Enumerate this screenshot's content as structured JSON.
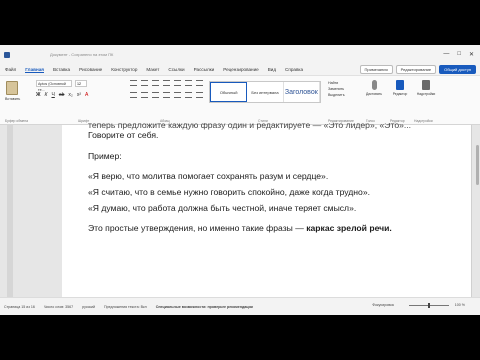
{
  "window": {
    "title": "Документ - Сохранено на этом ПК",
    "controls": [
      "—",
      "□",
      "✕"
    ]
  },
  "menu": {
    "items": [
      "Файл",
      "Главная",
      "Вставка",
      "Рисование",
      "Конструктор",
      "Макет",
      "Ссылки",
      "Рассылки",
      "Рецензирование",
      "Вид",
      "Справка"
    ],
    "active_index": 1,
    "comments_label": "Примечания",
    "editing_label": "Редактирование",
    "share_label": "Общий доступ"
  },
  "ribbon": {
    "paste_label": "Вставить",
    "font_name": "Aptos (Основной те...",
    "font_size": "12",
    "format_buttons": [
      "Ж",
      "К",
      "Ч",
      "ab",
      "x₂",
      "x²",
      "A"
    ],
    "styles": [
      "Обычный",
      "Без интервала",
      "Заголовок"
    ],
    "edit_items": [
      "Найти",
      "Заменить",
      "Выделить"
    ],
    "dictate_label": "Диктовать",
    "editor_label": "Редактор",
    "addins_label": "Надстройки",
    "group_labels": {
      "clipboard": "Буфер обмена",
      "font": "Шрифт",
      "paragraph": "Абзац",
      "styles": "Стили",
      "editing": "Редактирование",
      "voice": "Голос",
      "editor": "Редактор",
      "addins": "Надстройки"
    }
  },
  "document": {
    "line_top": "теперь предложите каждую фразу один и редактируете — «Это лидер», «Это»...",
    "line1": "Говорите от себя.",
    "line2": "Пример:",
    "line3": "«Я верю, что молитва помогает сохранять разум и сердце».",
    "line4": "«Я считаю, что в семье нужно говорить спокойно, даже когда трудно».",
    "line5": "«Я думаю, что работа должна быть честной, иначе теряет смысл».",
    "line6_plain": "Это простые утверждения, но именно такие фразы — ",
    "line6_bold": "каркас зрелой речи."
  },
  "status": {
    "page": "Страница 15 из 16",
    "words": "Число слов: 3567",
    "language": "русский",
    "predictions": "Предложения текста: Вкл",
    "accessibility": "Специальные возможности: проверьте рекомендации",
    "focus": "Фокусировка",
    "zoom": "100 %"
  }
}
